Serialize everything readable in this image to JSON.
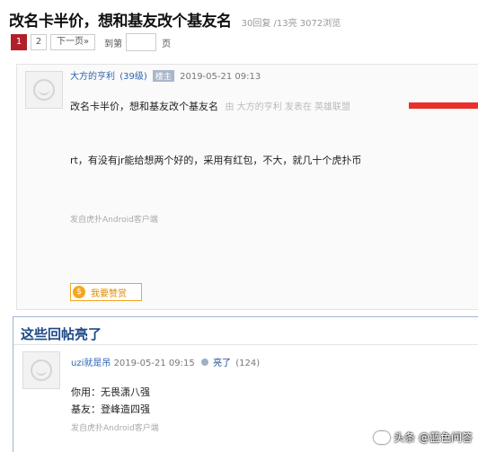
{
  "thread": {
    "title": "改名卡半价，想和基友改个基友名",
    "stats": "30回复 /13亮   3072浏览"
  },
  "pager": {
    "pages": [
      "1",
      "2"
    ],
    "next": "下一页»",
    "goto": "到第",
    "page_unit": "页"
  },
  "post": {
    "username": "大方的亨利",
    "level": "(39级)",
    "badge": "楼主",
    "time": "2019-05-21 09:13",
    "title": "改名卡半价，想和基友改个基友名",
    "origin": "由 大方的亨利 发表在 英雄联盟",
    "body": "rt，有没有jr能给想两个好的，采用有红包，不大，就几十个虎扑币",
    "source": "发自虎扑Android客户端",
    "reward": "我要赞赏"
  },
  "hot": {
    "title": "这些回帖亮了",
    "reply": {
      "username": "uzi就是吊",
      "time": "2019-05-21 09:15",
      "liked": "亮了",
      "like_count": "(124)",
      "line1": "你用：无畏潇八强",
      "line2": "基友：登峰造四强",
      "source": "发自虎扑Android客户端"
    }
  },
  "watermark": "头条 @蓝色问答"
}
